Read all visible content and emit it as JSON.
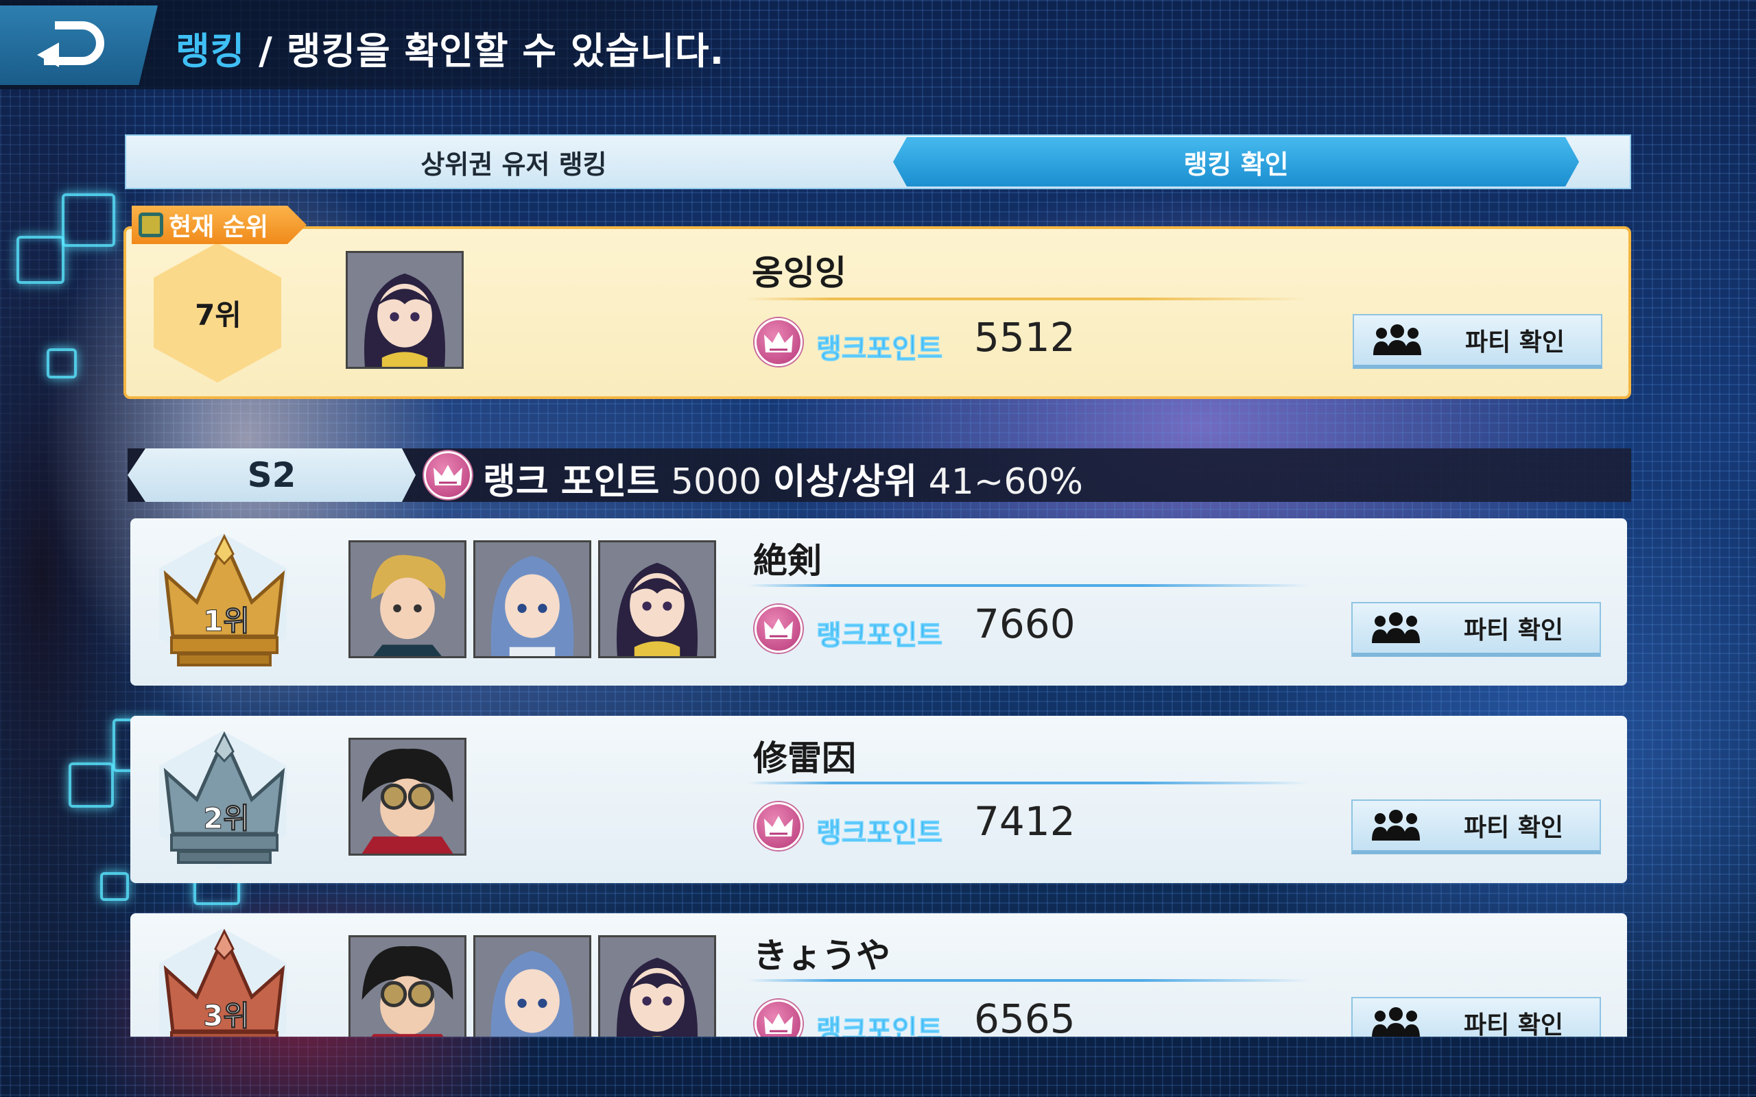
{
  "header": {
    "title_accent": "랭킹",
    "title_rest": " / 랭킹을 확인할 수 있습니다."
  },
  "tabs": [
    {
      "label": "상위권 유저 랭킹",
      "active": false
    },
    {
      "label": "랭킹 확인",
      "active": true
    }
  ],
  "current": {
    "tag": "현재 순위",
    "rank": "7위",
    "name": "옹잉잉",
    "rp_label": "랭크포인트",
    "rp_value": "5512",
    "party_label": "파티 확인"
  },
  "tier": {
    "badge": "S2",
    "rp_text": "랭크 포인트",
    "threshold": "5000",
    "suffix": "이상/상위",
    "range": "41~60%"
  },
  "rows": [
    {
      "rank": "1위",
      "name": "絶剣",
      "rp_label": "랭크포인트",
      "rp_value": "7660",
      "party_label": "파티 확인",
      "crown_color": "#d9a441"
    },
    {
      "rank": "2위",
      "name": "修雷因",
      "rp_label": "랭크포인트",
      "rp_value": "7412",
      "party_label": "파티 확인",
      "crown_color": "#7f9aa8"
    },
    {
      "rank": "3위",
      "name": "きょうや",
      "rp_label": "랭크포인트",
      "rp_value": "6565",
      "party_label": "파티 확인",
      "crown_color": "#c4644a"
    }
  ],
  "icons": {
    "back": "back-arrow-icon",
    "rank_point": "crown-icon",
    "party": "group-icon"
  },
  "colors": {
    "accent": "#3fc0f5",
    "tab_active": "#1b8fd0",
    "current_border": "#f4b642",
    "rp_label": "#27a8e4"
  }
}
